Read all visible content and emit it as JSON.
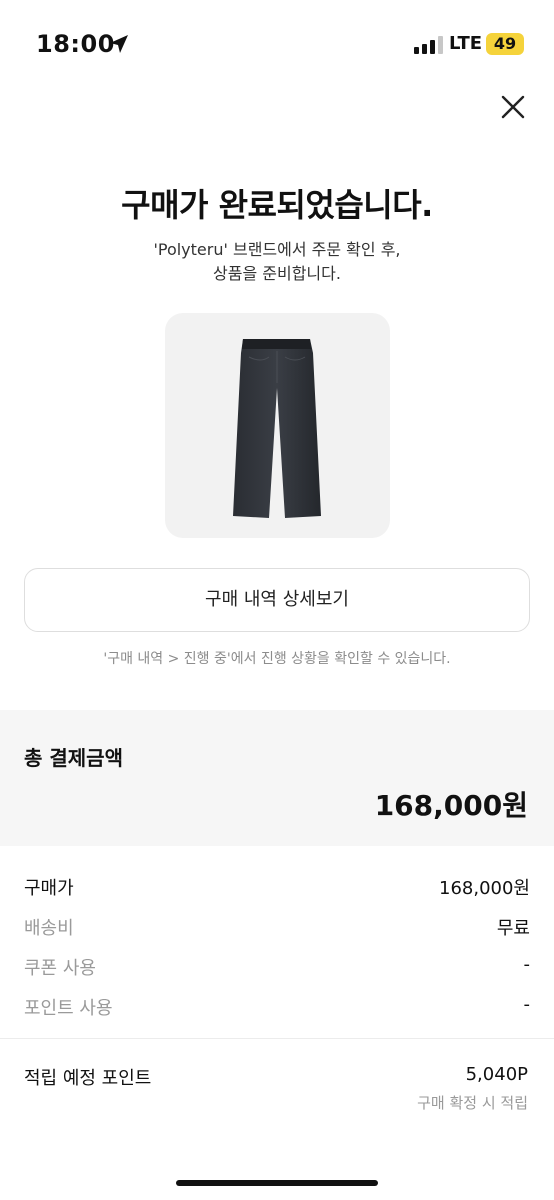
{
  "status": {
    "time": "18:00",
    "network": "LTE",
    "battery": "49",
    "icons": [
      "location-arrow-icon",
      "signal-icon"
    ]
  },
  "header": {
    "close_icon": "close-icon"
  },
  "main": {
    "title": "구매가 완료되었습니다.",
    "subtitle_line1": "'Polyteru' 브랜드에서 주문 확인 후,",
    "subtitle_line2": "상품을 준비합니다.",
    "detail_button": "구매 내역 상세보기",
    "hint": "'구매 내역 > 진행 중'에서 진행 상황을 확인할 수 있습니다."
  },
  "total": {
    "label": "총 결제금액",
    "amount": "168,000원"
  },
  "breakdown": [
    {
      "label": "구매가",
      "value": "168,000원",
      "muted": false
    },
    {
      "label": "배송비",
      "value": "무료",
      "muted": true
    },
    {
      "label": "쿠폰 사용",
      "value": "-",
      "muted": true
    },
    {
      "label": "포인트 사용",
      "value": "-",
      "muted": true
    }
  ],
  "reward": {
    "label": "적립 예정 포인트",
    "value": "5,040P",
    "note": "구매 확정 시 적립"
  },
  "colors": {
    "battery": "#f5d33b",
    "muted_text": "#9a9a9a",
    "summary_bg": "#f6f6f6"
  }
}
